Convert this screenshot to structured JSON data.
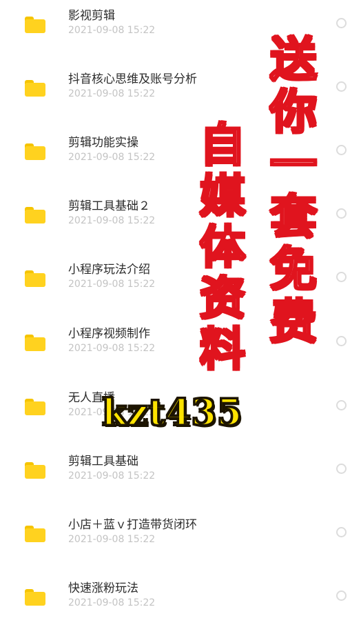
{
  "files": [
    {
      "name": "影视剪辑",
      "date": "2021-09-08 15:22"
    },
    {
      "name": "抖音核心思维及账号分析",
      "date": "2021-09-08 15:22"
    },
    {
      "name": "剪辑功能实操",
      "date": "2021-09-08 15:22"
    },
    {
      "name": "剪辑工具基础２",
      "date": "2021-09-08 15:22"
    },
    {
      "name": "小程序玩法介绍",
      "date": "2021-09-08 15:22"
    },
    {
      "name": "小程序视频制作",
      "date": "2021-09-08 15:22"
    },
    {
      "name": "无人直播",
      "date": "2021-09-08 15:22"
    },
    {
      "name": "剪辑工具基础",
      "date": "2021-09-08 15:22"
    },
    {
      "name": "小店＋蓝ｖ打造带货闭环",
      "date": "2021-09-08 15:22"
    },
    {
      "name": "快速涨粉玩法",
      "date": "2021-09-08 15:22"
    }
  ],
  "overlay": {
    "right_column": [
      "送",
      "你",
      "一",
      "套",
      "免",
      "费"
    ],
    "left_column": [
      "自",
      "媒",
      "体",
      "资",
      "料"
    ],
    "code": "kzt435"
  },
  "colors": {
    "folder": "#ffd21f",
    "overlay_outline": "#e0141e",
    "code_fill": "#ffe300"
  }
}
